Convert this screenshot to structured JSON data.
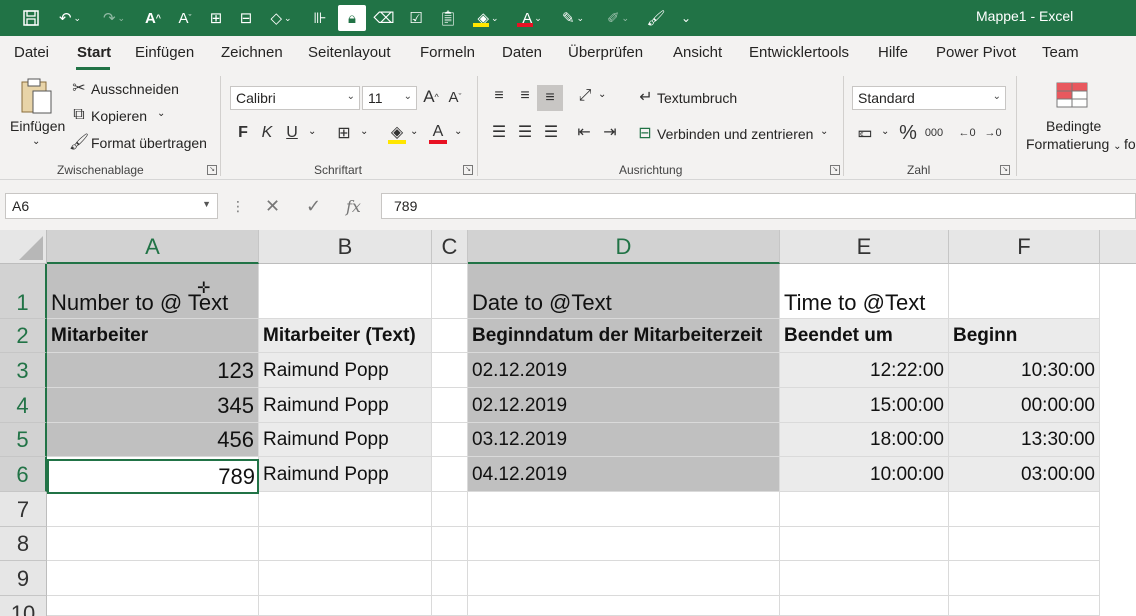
{
  "app": {
    "title": "Mappe1",
    "app_name": "Excel",
    "title_sep": "-"
  },
  "qat": {
    "icons": [
      "save-icon",
      "undo-icon",
      "redo-icon",
      "increase-font-icon",
      "decrease-font-icon",
      "borders-icon",
      "table-icon",
      "shapes-icon",
      "columns-icon",
      "lock-icon",
      "clear-format-icon",
      "checklist-icon",
      "paste-icon",
      "fill-color-icon",
      "font-color-icon",
      "pen-icon",
      "highlighter-icon",
      "format-painter-icon",
      "customize-icon"
    ]
  },
  "tabs": [
    "Datei",
    "Start",
    "Einfügen",
    "Zeichnen",
    "Seitenlayout",
    "Formeln",
    "Daten",
    "Überprüfen",
    "Ansicht",
    "Entwicklertools",
    "Hilfe",
    "Power Pivot",
    "Team"
  ],
  "active_tab": "Start",
  "ribbon": {
    "clipboard": {
      "paste": "Einfügen",
      "cut": "Ausschneiden",
      "copy": "Kopieren",
      "format_painter": "Format übertragen",
      "label": "Zwischenablage"
    },
    "font": {
      "name": "Calibri",
      "size": "11",
      "bold": "F",
      "italic": "K",
      "underline": "U",
      "label": "Schriftart"
    },
    "alignment": {
      "wrap": "Textumbruch",
      "merge": "Verbinden und zentrieren",
      "label": "Ausrichtung"
    },
    "number": {
      "format": "Standard",
      "percent": "%",
      "thousands": "000",
      "label": "Zahl"
    },
    "styles": {
      "conditional_1": "Bedingte",
      "conditional_2": "Formatierung",
      "next_cut": "fo"
    }
  },
  "formula_bar": {
    "name_box": "A6",
    "cancel": "✕",
    "enter": "✓",
    "fx": "fx",
    "value": "789"
  },
  "sheet": {
    "columns": [
      "A",
      "B",
      "C",
      "D",
      "E",
      "F"
    ],
    "rows": [
      "1",
      "2",
      "3",
      "4",
      "5",
      "6",
      "7",
      "8",
      "9",
      "10"
    ],
    "cells": {
      "A1": "Number to @ Text",
      "D1": "Date to @Text",
      "E1": "Time to @Text",
      "A2": "Mitarbeiter",
      "B2": "Mitarbeiter (Text)",
      "D2": "Beginndatum der Mitarbeiterzeit",
      "E2": "Beendet um",
      "F2": "Beginn",
      "A3": "123",
      "B3": "Raimund Popp",
      "D3": "02.12.2019",
      "E3": "12:22:00",
      "F3": "10:30:00",
      "A4": "345",
      "B4": "Raimund Popp",
      "D4": "02.12.2019",
      "E4": "15:00:00",
      "F4": "00:00:00",
      "A5": "456",
      "B5": "Raimund Popp",
      "D5": "03.12.2019",
      "E5": "18:00:00",
      "F5": "13:30:00",
      "A6": "789",
      "B6": "Raimund Popp",
      "D6": "04.12.2019",
      "E6": "10:00:00",
      "F6": "03:00:00"
    }
  },
  "colors": {
    "accent": "#217346",
    "ribbon_bg": "#f3f2f1",
    "shade_dark": "#c0c0c0",
    "shade_light": "#ebebeb"
  }
}
